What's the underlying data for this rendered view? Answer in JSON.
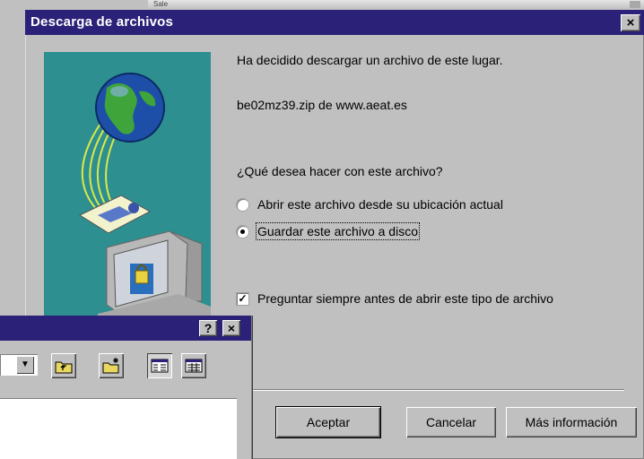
{
  "dialog": {
    "title": "Descarga de archivos",
    "close_glyph": "×",
    "message": "Ha decidido descargar un archivo de este lugar.",
    "filename": "be02mz39.zip de www.aeat.es",
    "question": "¿Qué desea hacer con este archivo?",
    "options": [
      {
        "label": "Abrir este archivo desde su ubicación actual",
        "selected": false
      },
      {
        "label": "Guardar este archivo a disco",
        "selected": true
      }
    ],
    "checkbox": {
      "label": "Preguntar siempre antes de abrir este tipo de archivo",
      "checked": true,
      "glyph": "✓"
    },
    "buttons": {
      "accept": "Aceptar",
      "cancel": "Cancelar",
      "more_info": "Más información"
    }
  },
  "secondary_window": {
    "help_glyph": "?",
    "close_glyph": "×",
    "combo_arrow": "▼"
  },
  "background_window": {
    "tab_label": "Sale"
  },
  "colors": {
    "title_bar": "#2b2178",
    "face": "#c0c0c0",
    "illustration_bg": "#2e8f90"
  }
}
